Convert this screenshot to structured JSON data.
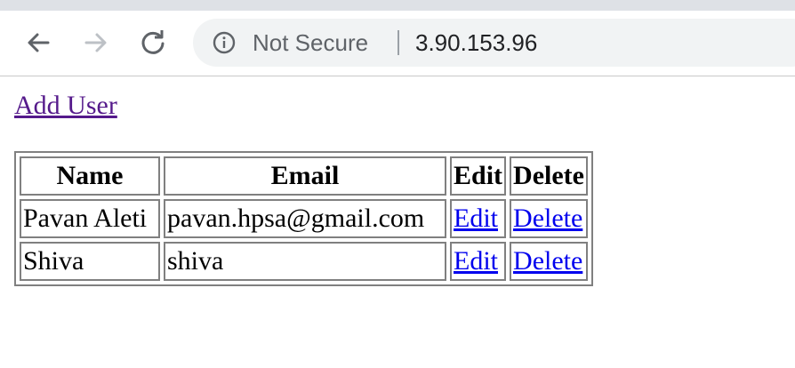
{
  "browser": {
    "security_label": "Not Secure",
    "url": "3.90.153.96",
    "icons": {
      "back": "back-arrow-icon",
      "forward": "forward-arrow-icon",
      "reload": "reload-icon",
      "info": "info-icon"
    },
    "colors": {
      "tab_strip": "#dee1e6",
      "omnibox_bg": "#f1f3f4",
      "security_text": "#5f6368",
      "url_text": "#202124"
    }
  },
  "page": {
    "add_user_label": "Add User",
    "table": {
      "headers": [
        "Name",
        "Email",
        "Edit",
        "Delete"
      ],
      "rows": [
        {
          "name": "Pavan Aleti",
          "email": "pavan.hpsa@gmail.com",
          "edit": "Edit",
          "delete": "Delete"
        },
        {
          "name": "Shiva",
          "email": "shiva",
          "edit": "Edit",
          "delete": "Delete"
        }
      ]
    },
    "colors": {
      "visited_link": "#551a8b",
      "link": "#0000ee",
      "table_border": "#808080"
    }
  }
}
